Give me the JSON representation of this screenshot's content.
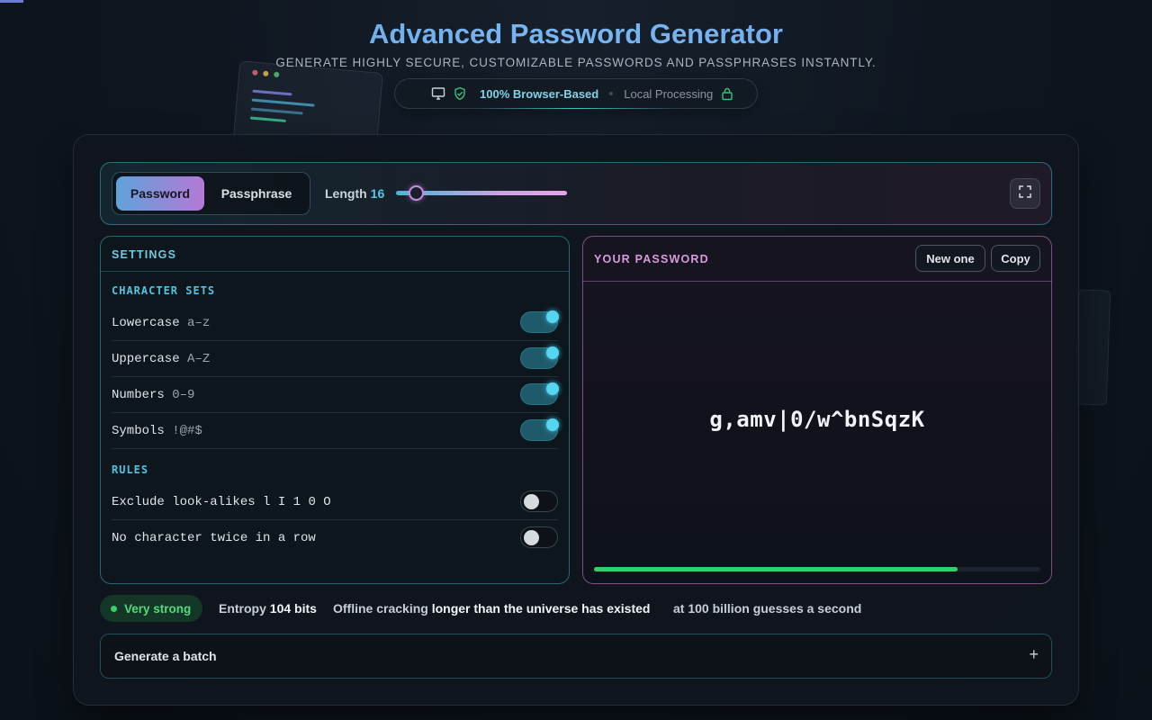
{
  "header": {
    "title": "Advanced Password Generator",
    "subtitle": "GENERATE HIGHLY SECURE, CUSTOMIZABLE PASSWORDS AND PASSPHRASES INSTANTLY.",
    "badge_primary": "100% Browser-Based",
    "badge_secondary": "Local Processing",
    "icons": [
      "monitor-icon",
      "shield-check-icon",
      "lock-icon"
    ]
  },
  "toolbar": {
    "modes": [
      "Password",
      "Passphrase"
    ],
    "active_mode": "Password",
    "length_label": "Length",
    "length_value": "16",
    "length_slider": {
      "value": 16,
      "fill_fraction": 0.11
    },
    "expand_icon": "expand-icon"
  },
  "settings": {
    "title": "SETTINGS",
    "character_sets_label": "CHARACTER SETS",
    "character_sets": [
      {
        "label": "Lowercase",
        "hint": "a–z",
        "enabled": true
      },
      {
        "label": "Uppercase",
        "hint": "A–Z",
        "enabled": true
      },
      {
        "label": "Numbers",
        "hint": "0–9",
        "enabled": true
      },
      {
        "label": "Symbols",
        "hint": "!@#$",
        "enabled": true
      }
    ],
    "rules_label": "RULES",
    "rules": [
      {
        "label": "Exclude look-alikes",
        "hint": "l I 1 0 O",
        "enabled": false
      },
      {
        "label": "No character twice in a row",
        "hint": "",
        "enabled": false
      }
    ]
  },
  "password_panel": {
    "title": "YOUR PASSWORD",
    "new_button": "New one",
    "copy_button": "Copy",
    "password": "g,amv|0/w^bnSqzK",
    "strength_fraction": 0.814
  },
  "stats": {
    "strength_label": "Very strong",
    "entropy_prefix": "Entropy",
    "entropy_value": "104 bits",
    "cracking_prefix": "Offline cracking",
    "cracking_value": "longer than the universe has existed",
    "rate_text": "at 100 billion guesses a second"
  },
  "batch": {
    "label": "Generate a batch",
    "toggle": "+"
  },
  "colors": {
    "accent_cyan": "#54c9e6",
    "accent_purple": "#c78be0",
    "strength_green": "#34d06a"
  }
}
